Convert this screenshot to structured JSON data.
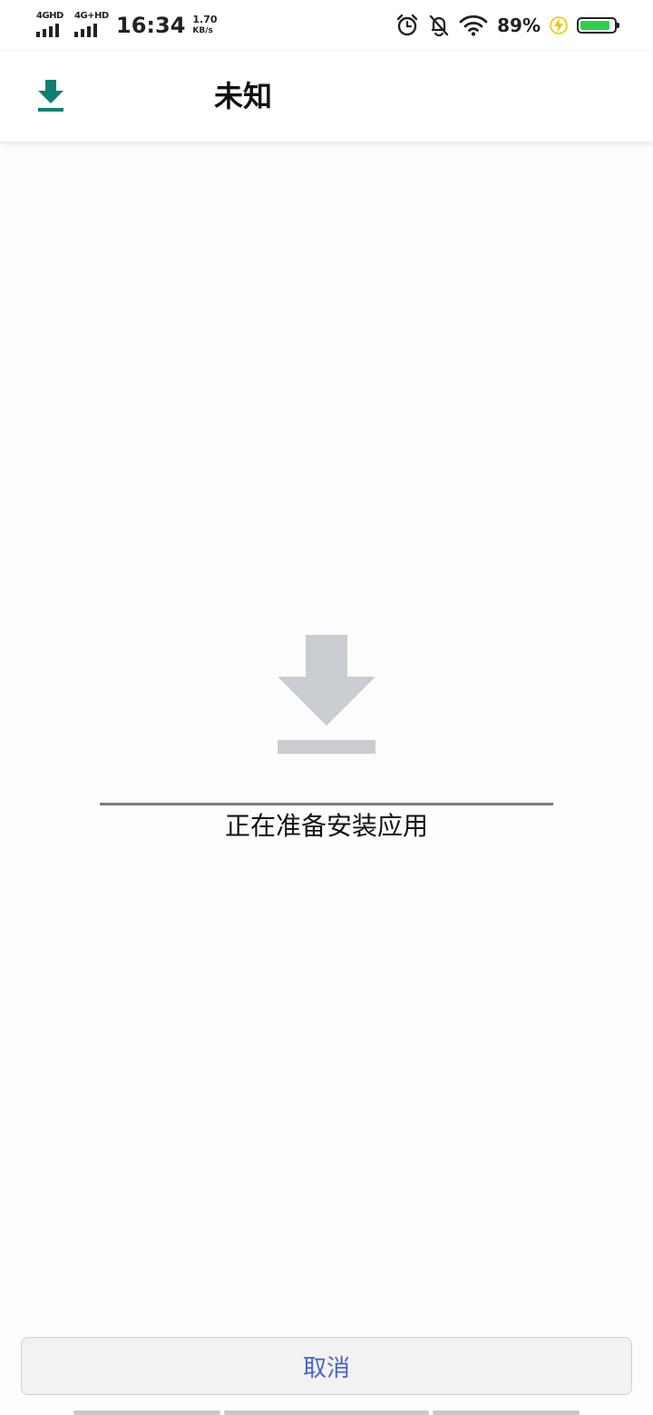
{
  "status_bar": {
    "sim1_label": "4GHD",
    "sim2_label": "4G+HD",
    "time": "16:34",
    "net_speed_value": "1.70",
    "net_speed_unit": "KB/s",
    "icons": [
      "alarm-icon",
      "bell-off-icon",
      "wifi-icon",
      "charging-bolt-icon",
      "battery-icon"
    ],
    "battery_percent": "89%",
    "battery_level": 0.89,
    "battery_color": "#2ecf4a",
    "charging_color": "#f5c400"
  },
  "app_bar": {
    "title": "未知",
    "icon": "download-icon",
    "icon_color": "#0f7f74"
  },
  "main": {
    "illustration_icon": "download-icon",
    "illustration_color": "#c9ccd0",
    "status_text": "正在准备安装应用"
  },
  "footer": {
    "cancel_label": "取消",
    "cancel_color": "#4a63c9"
  }
}
